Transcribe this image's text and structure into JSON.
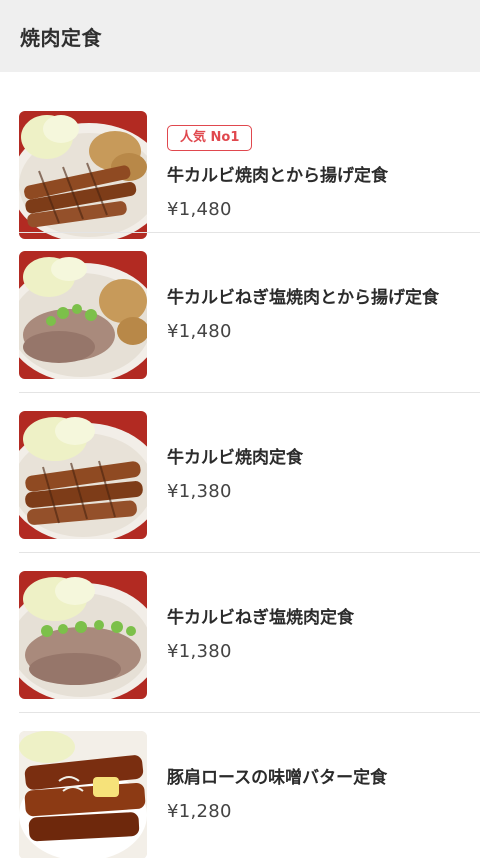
{
  "header": {
    "title": "焼肉定食"
  },
  "items": [
    {
      "name": "牛カルビ焼肉とから揚げ定食",
      "price": "¥1,480",
      "badge": "人気 No1",
      "image": "beef-karaage-plate"
    },
    {
      "name": "牛カルビねぎ塩焼肉とから揚げ定食",
      "price": "¥1,480",
      "badge": "",
      "image": "beef-negishio-karaage-plate"
    },
    {
      "name": "牛カルビ焼肉定食",
      "price": "¥1,380",
      "badge": "",
      "image": "beef-plate"
    },
    {
      "name": "牛カルビねぎ塩焼肉定食",
      "price": "¥1,380",
      "badge": "",
      "image": "beef-negishio-plate"
    },
    {
      "name": "豚肩ロースの味噌バター定食",
      "price": "¥1,280",
      "badge": "",
      "image": "pork-miso-butter-bowl"
    }
  ],
  "colors": {
    "badge": "#e0484e",
    "header_bg": "#efefef"
  }
}
